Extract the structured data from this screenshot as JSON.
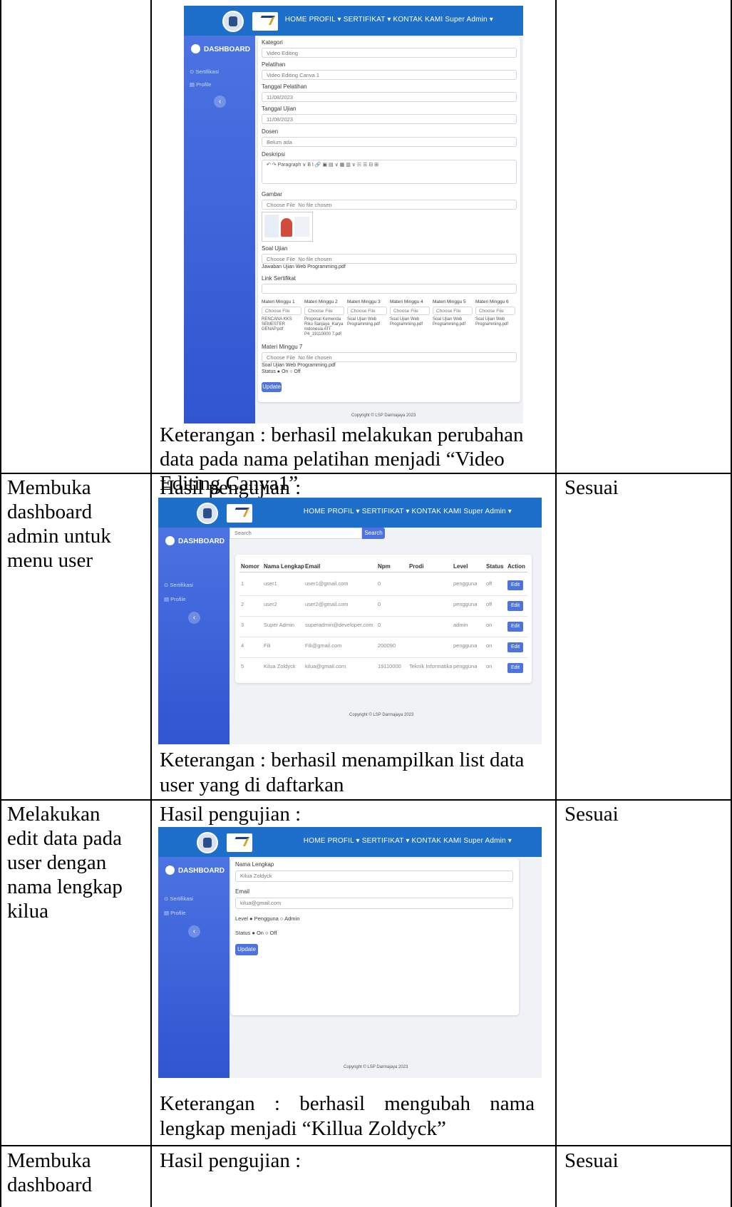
{
  "rows": [
    {
      "keterangan_lines": [
        "Keterangan : berhasil melakukan perubahan",
        "data pada nama pelatihan menjadi “Video",
        "Editing Canva1”"
      ]
    },
    {
      "skenario_lines": [
        "Membuka",
        "dashboard",
        "admin untuk",
        "menu user"
      ],
      "hasil_label": "Hasil pengujian :",
      "keterangan_lines": [
        "Keterangan : berhasil menampilkan list data",
        "user yang di daftarkan"
      ],
      "status": "Sesuai"
    },
    {
      "skenario_lines": [
        "Melakukan",
        "edit data pada",
        "user dengan",
        "nama lengkap",
        "kilua"
      ],
      "hasil_label": "Hasil pengujian :",
      "keterangan_lines": [
        "Keterangan : berhasil mengubah nama",
        "lengkap menjadi “Killua Zoldyck”"
      ],
      "status": "Sesuai"
    },
    {
      "skenario_lines": [
        "Membuka",
        "dashboard"
      ],
      "hasil_label": "Hasil pengujian :",
      "status": "Sesuai"
    }
  ],
  "app": {
    "nav": "HOME  PROFIL ▾  SERTIFIKAT ▾  KONTAK KAMI  Super Admin ▾",
    "sidebar_title": "DASHBOARD",
    "sidebar_items": [
      "⊙ Sertifikasi",
      "▤ Profile"
    ],
    "footer": "Copyright © LSP Darmajaya 2023"
  },
  "screen1": {
    "fields": [
      {
        "label": "Kategori",
        "value": "Video Editing"
      },
      {
        "label": "Pelatihan",
        "value": "Video Editing Canva 1"
      },
      {
        "label": "Tanggal Pelatihan",
        "value": "11/08/2023"
      },
      {
        "label": "Tanggal Ujian",
        "value": "11/08/2023"
      },
      {
        "label": "Dosen",
        "value": "Belum ada"
      }
    ],
    "deskripsi_label": "Deskripsi",
    "toolbar": "↶  ↷  Paragraph  ∨  B  I  🔗  ▣  ▤ ∨  ▦  ▥ ∨  ☷  ☰  ⊟  ⊞",
    "gambar_label": "Gambar",
    "choose_file": "Choose File",
    "no_file": "No file chosen",
    "soal_label": "Soal Ujian",
    "soal_file": "Jawaban Ujian Web Programming.pdf",
    "link_label": "Link Sertifikat",
    "materi": [
      {
        "label": "Materi Minggu 1",
        "file": "RENCANA KKS SEMESTER GENAP.pdf"
      },
      {
        "label": "Materi Minggu 2",
        "file": "Proposal Kemenda Riku Sanjaya_Karya Indonesia ATI P4_19110000 7.pdf"
      },
      {
        "label": "Materi Minggu 3",
        "file": "Soal Ujian Web Programming.pdf"
      },
      {
        "label": "Materi Minggu 4",
        "file": "Soal Ujian Web Programming.pdf"
      },
      {
        "label": "Materi Minggu 5",
        "file": "Soal Ujian Web Programming.pdf"
      },
      {
        "label": "Materi Minggu 6",
        "file": "Soal Ujian Web Programming.pdf"
      }
    ],
    "materi7_label": "Materi Minggu 7",
    "materi7_file": "Soal Ujian Web Programming.pdf",
    "status_line": "Status ● On ○ Off",
    "update": "Update"
  },
  "screen2": {
    "search_placeholder": "Search",
    "search_button": "Search",
    "headers": [
      "Nomor",
      "Nama Lengkap",
      "Email",
      "Npm",
      "Prodi",
      "Level",
      "Status",
      "Action"
    ],
    "rows": [
      [
        "1",
        "user1",
        "user1@gmail.com",
        "0",
        "",
        "pengguna",
        "off"
      ],
      [
        "2",
        "user2",
        "user2@gmail.com",
        "0",
        "",
        "pengguna",
        "off"
      ],
      [
        "3",
        "Super Admin",
        "superadmin@developer.com",
        "0",
        "",
        "admin",
        "on"
      ],
      [
        "4",
        "Fili",
        "Fili@gmail.com",
        "200090",
        "",
        "pengguna",
        "on"
      ],
      [
        "5",
        "Kilua Zoldyck",
        "kilua@gmail.com",
        "19110000",
        "Teknik Informatika",
        "pengguna",
        "on"
      ]
    ],
    "edit": "Edit"
  },
  "screen3": {
    "nama_label": "Nama Lengkap",
    "nama_value": "Kilua Zoldyck",
    "email_label": "Email",
    "email_value": "kilua@gmail.com",
    "level_line": "Level ● Pengguna ○ Admin",
    "status_line": "Status ● On ○ Off",
    "update": "Update"
  }
}
